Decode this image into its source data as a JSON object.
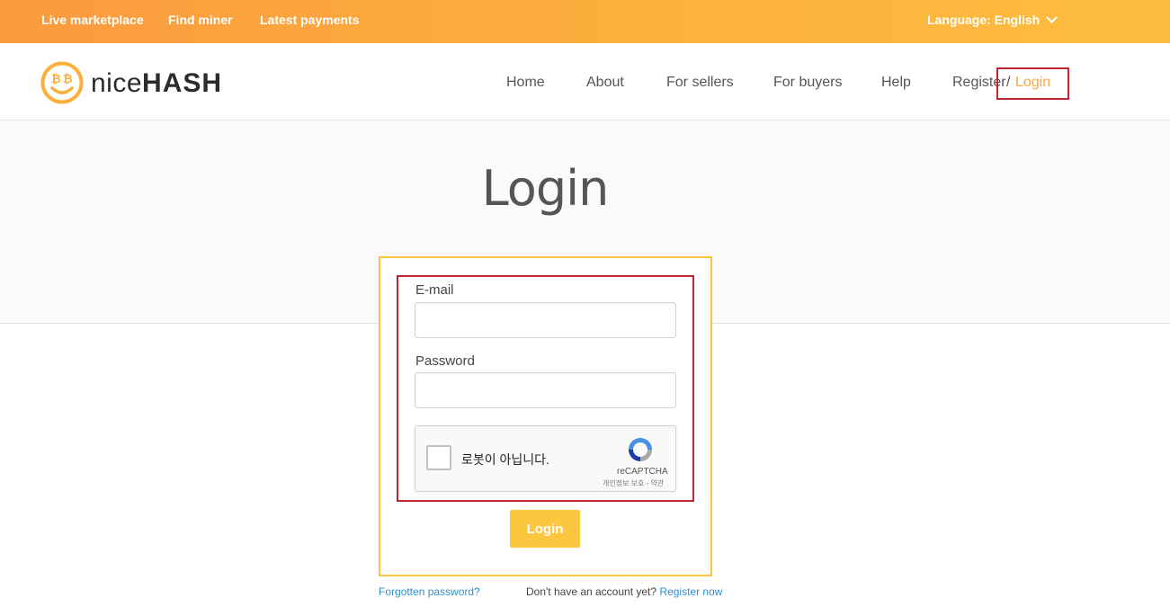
{
  "topbar": {
    "links": [
      "Live marketplace",
      "Find miner",
      "Latest payments"
    ],
    "language_label": "Language: English"
  },
  "header": {
    "logo_text_light": "nice",
    "logo_text_bold": "HASH",
    "nav": [
      "Home",
      "About",
      "For sellers",
      "For buyers",
      "Help"
    ],
    "register_label": "Register",
    "separator": "/",
    "login_label": "Login"
  },
  "page": {
    "title": "Login"
  },
  "form": {
    "email_label": "E-mail",
    "email_value": "",
    "password_label": "Password",
    "password_value": "",
    "captcha_text": "로봇이 아닙니다.",
    "captcha_brand": "reCAPTCHA",
    "captcha_terms": "개인정보 보호 - 약관",
    "submit_label": "Login"
  },
  "footer": {
    "forgot_label": "Forgotten password?",
    "no_account_text": "Don't have an account yet?",
    "register_now_label": "Register now"
  },
  "colors": {
    "accent_orange": "#fba73b",
    "button_yellow": "#fcc63f",
    "highlight_red": "#c0262d",
    "link_blue": "#2e8fd0"
  }
}
